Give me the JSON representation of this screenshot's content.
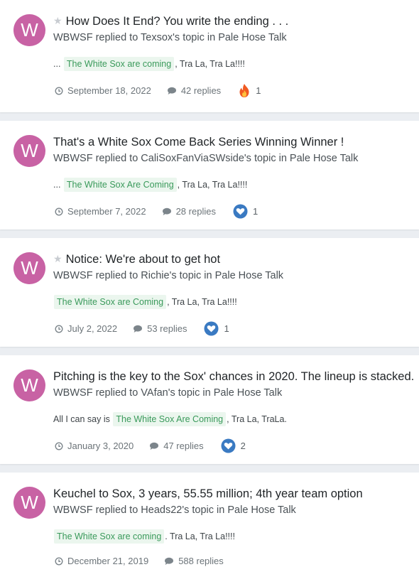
{
  "activity": [
    {
      "starred": true,
      "title": "How Does It End? You write the ending . . .",
      "avatar_letter": "W",
      "author": "WBWSF",
      "mid1": " replied to ",
      "topic_owner": "Texsox's",
      "mid2": " topic in ",
      "forum": "Pale Hose Talk",
      "snippet_prefix": "... ",
      "snippet_highlight": "The White Sox are coming",
      "snippet_suffix": ", Tra La, Tra La!!!!",
      "date": "September 18, 2022",
      "replies": "42 replies",
      "reaction_icon": "fire-icon",
      "reaction_count": "1"
    },
    {
      "starred": false,
      "title": "That's a White Sox Come Back Series Winning Winner !",
      "avatar_letter": "W",
      "author": "WBWSF",
      "mid1": " replied to ",
      "topic_owner": "CaliSoxFanViaSWside's",
      "mid2": " topic in ",
      "forum": "Pale Hose Talk",
      "snippet_prefix": "... ",
      "snippet_highlight": "The White Sox Are Coming",
      "snippet_suffix": ", Tra La, Tra La!!!!",
      "date": "September 7, 2022",
      "replies": "28 replies",
      "reaction_icon": "heart-icon",
      "reaction_count": "1"
    },
    {
      "starred": true,
      "title": "Notice: We're about to get hot",
      "avatar_letter": "W",
      "author": "WBWSF",
      "mid1": " replied to ",
      "topic_owner": "Richie's",
      "mid2": " topic in ",
      "forum": "Pale Hose Talk",
      "snippet_prefix": "",
      "snippet_highlight": "The White Sox are Coming",
      "snippet_suffix": ", Tra La, Tra La!!!!",
      "date": "July 2, 2022",
      "replies": "53 replies",
      "reaction_icon": "heart-icon",
      "reaction_count": "1"
    },
    {
      "starred": false,
      "title": "Pitching is the key to the Sox' chances in 2020. The lineup is stacked.",
      "avatar_letter": "W",
      "author": "WBWSF",
      "mid1": " replied to ",
      "topic_owner": "VAfan's",
      "mid2": " topic in ",
      "forum": "Pale Hose Talk",
      "snippet_prefix": "All I can say is ",
      "snippet_highlight": "The White Sox Are Coming",
      "snippet_suffix": ", Tra La, TraLa.",
      "date": "January 3, 2020",
      "replies": "47 replies",
      "reaction_icon": "heart-icon",
      "reaction_count": "2"
    },
    {
      "starred": false,
      "title": "Keuchel to Sox, 3 years, 55.55 million; 4th year team option",
      "avatar_letter": "W",
      "author": "WBWSF",
      "mid1": " replied to ",
      "topic_owner": "Heads22's",
      "mid2": " topic in ",
      "forum": "Pale Hose Talk",
      "snippet_prefix": "",
      "snippet_highlight": "The White Sox are coming",
      "snippet_suffix": ". Tra La, Tra La!!!!",
      "date": "December 21, 2019",
      "replies": "588 replies",
      "reaction_icon": "",
      "reaction_count": ""
    }
  ],
  "colors": {
    "avatar": "#c862a4",
    "highlight_bg": "#ebf6ee",
    "highlight_text": "#3a9a5b",
    "heart": "#3a7ac2",
    "fire": "#f05a22"
  }
}
